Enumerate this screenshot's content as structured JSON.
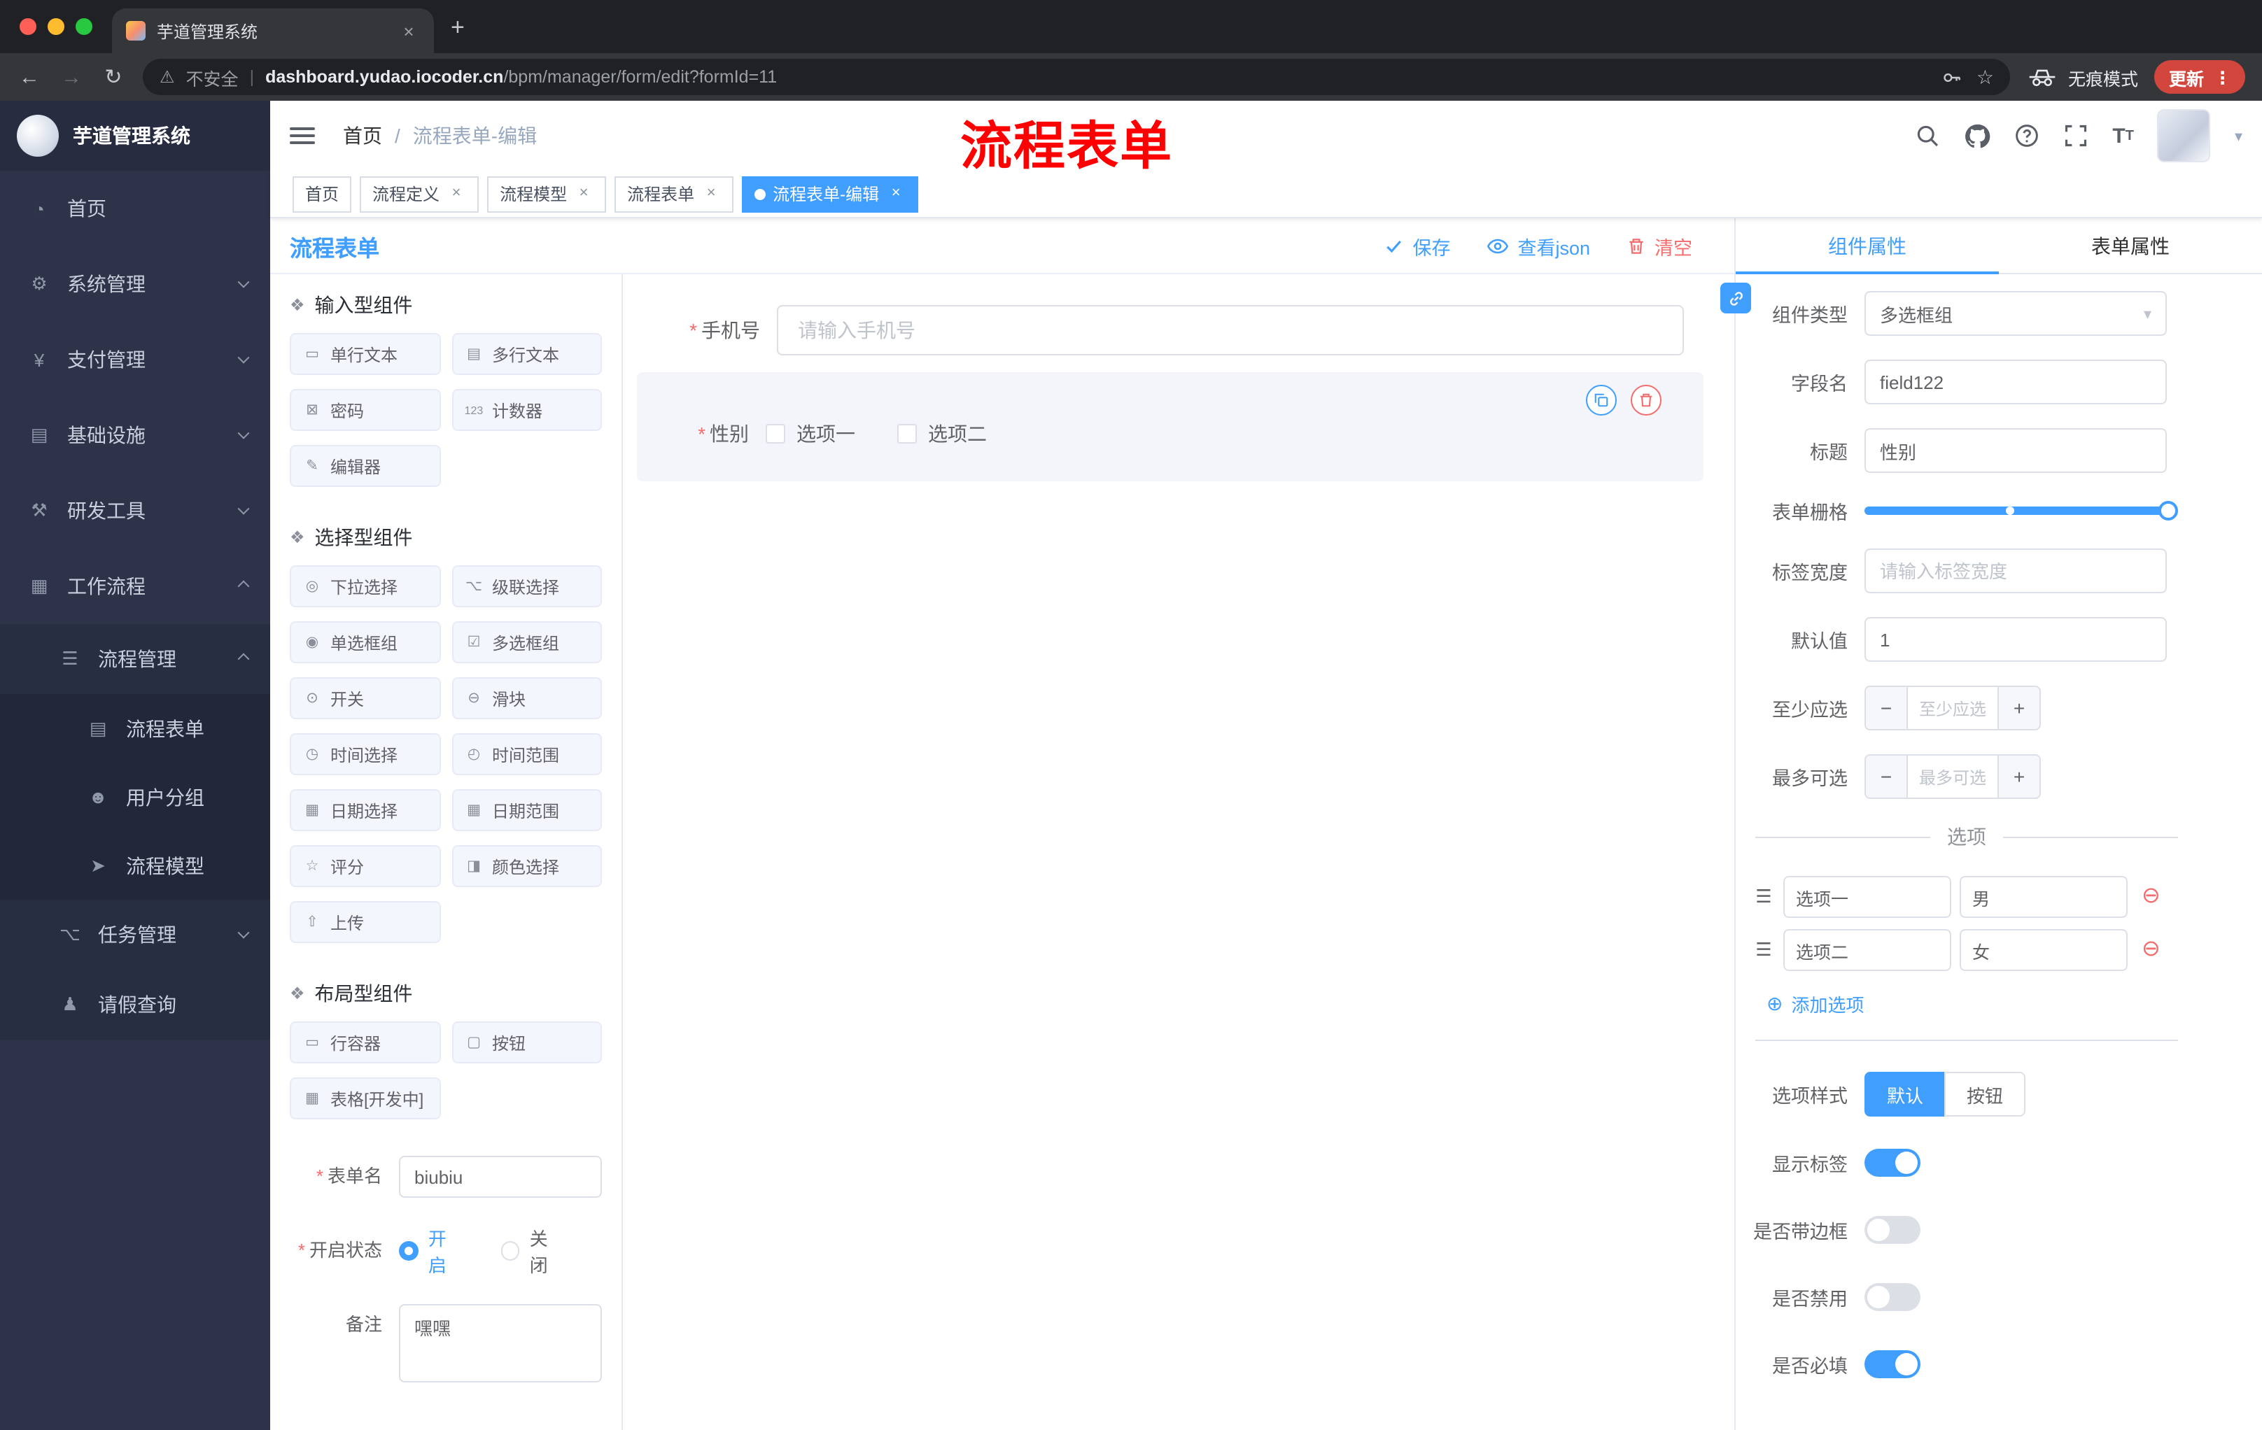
{
  "browser": {
    "tab_title": "芋道管理系统",
    "security_warning": "不安全",
    "url_domain": "dashboard.yudao.iocoder.cn",
    "url_path": "/bpm/manager/form/edit?formId=11",
    "incognito_label": "无痕模式",
    "update_button": "更新",
    "icons": [
      "back-icon",
      "forward-icon",
      "reload-icon",
      "warning-icon",
      "key-icon",
      "star-icon",
      "incognito-icon",
      "menu-dots-icon"
    ]
  },
  "glyphs": {
    "close": "×",
    "plus": "+",
    "minus": "−",
    "asterisk": "*",
    "slash": "/",
    "caret_down": "▾",
    "dots": "⋮",
    "back": "←",
    "forward": "→",
    "reload": "↻",
    "warning": "⚠",
    "star": "☆",
    "bar": "|",
    "drag": "☰",
    "remove": "⊖",
    "add": "⊕",
    "t_big": "T",
    "t_small": "T"
  },
  "sidebar": {
    "logo_title": "芋道管理系统",
    "menu": [
      {
        "label": "首页",
        "icon": "dashboard-icon",
        "glyph": "◔"
      },
      {
        "label": "系统管理",
        "icon": "gear-icon",
        "glyph": "⚙"
      },
      {
        "label": "支付管理",
        "icon": "payment-icon",
        "glyph": "¥"
      },
      {
        "label": "基础设施",
        "icon": "infrastructure-icon",
        "glyph": "▤"
      },
      {
        "label": "研发工具",
        "icon": "devtools-icon",
        "glyph": "⚒"
      },
      {
        "label": "工作流程",
        "icon": "workflow-icon",
        "glyph": "▦"
      },
      {
        "label": "流程管理",
        "icon": "process-management-icon",
        "glyph": "☰"
      },
      {
        "label": "流程表单",
        "icon": "process-form-icon",
        "glyph": "▤"
      },
      {
        "label": "用户分组",
        "icon": "user-group-icon",
        "glyph": "☻"
      },
      {
        "label": "流程模型",
        "icon": "process-model-icon",
        "glyph": "➤"
      },
      {
        "label": "任务管理",
        "icon": "task-management-icon",
        "glyph": "⌥"
      },
      {
        "label": "请假查询",
        "icon": "leave-query-icon",
        "glyph": "♟"
      }
    ]
  },
  "header": {
    "breadcrumb": [
      "首页",
      "流程表单-编辑"
    ],
    "annotation": "流程表单",
    "action_icons": [
      "search-icon",
      "github-icon",
      "help-icon",
      "fullscreen-icon",
      "font-size-icon",
      "avatar",
      "caret-down-icon"
    ]
  },
  "tags": [
    {
      "label": "首页",
      "closable": false,
      "active": false
    },
    {
      "label": "流程定义",
      "closable": true,
      "active": false
    },
    {
      "label": "流程模型",
      "closable": true,
      "active": false
    },
    {
      "label": "流程表单",
      "closable": true,
      "active": false
    },
    {
      "label": "流程表单-编辑",
      "closable": true,
      "active": true
    }
  ],
  "designer": {
    "panel_title": "流程表单",
    "toolbar": {
      "save": {
        "label": "保存",
        "icon": "check-icon"
      },
      "view_json": {
        "label": "查看json",
        "icon": "eye-icon"
      },
      "clear": {
        "label": "清空",
        "icon": "trash-icon"
      }
    }
  },
  "palette": {
    "sections": [
      {
        "title": "输入型组件",
        "icon": "component-icon",
        "glyph": "❖",
        "items": [
          {
            "label": "单行文本",
            "icon": "single-line-text-icon",
            "glyph": "▭"
          },
          {
            "label": "多行文本",
            "icon": "multiline-text-icon",
            "glyph": "▤"
          },
          {
            "label": "密码",
            "icon": "password-icon",
            "glyph": "⊠"
          },
          {
            "label": "计数器",
            "icon": "counter-icon",
            "glyph": "123"
          },
          {
            "label": "编辑器",
            "icon": "editor-icon",
            "glyph": "✎"
          }
        ]
      },
      {
        "title": "选择型组件",
        "icon": "component-icon",
        "glyph": "❖",
        "items": [
          {
            "label": "下拉选择",
            "icon": "select-icon",
            "glyph": "◎"
          },
          {
            "label": "级联选择",
            "icon": "cascader-icon",
            "glyph": "⌥"
          },
          {
            "label": "单选框组",
            "icon": "radio-group-icon",
            "glyph": "◉"
          },
          {
            "label": "多选框组",
            "icon": "checkbox-group-icon",
            "glyph": "☑"
          },
          {
            "label": "开关",
            "icon": "switch-icon",
            "glyph": "⊙"
          },
          {
            "label": "滑块",
            "icon": "slider-icon",
            "glyph": "⊖"
          },
          {
            "label": "时间选择",
            "icon": "time-picker-icon",
            "glyph": "◷"
          },
          {
            "label": "时间范围",
            "icon": "time-range-icon",
            "glyph": "◴"
          },
          {
            "label": "日期选择",
            "icon": "date-picker-icon",
            "glyph": "▦"
          },
          {
            "label": "日期范围",
            "icon": "date-range-icon",
            "glyph": "▦"
          },
          {
            "label": "评分",
            "icon": "rate-icon",
            "glyph": "☆"
          },
          {
            "label": "颜色选择",
            "icon": "color-picker-icon",
            "glyph": "◨"
          },
          {
            "label": "上传",
            "icon": "upload-icon",
            "glyph": "⇧"
          }
        ]
      },
      {
        "title": "布局型组件",
        "icon": "component-icon",
        "glyph": "❖",
        "items": [
          {
            "label": "行容器",
            "icon": "row-container-icon",
            "glyph": "▭"
          },
          {
            "label": "按钮",
            "icon": "button-icon",
            "glyph": "▢"
          },
          {
            "label": "表格[开发中]",
            "icon": "table-icon",
            "glyph": "▦"
          }
        ]
      }
    ],
    "form": {
      "name_label": "表单名",
      "name_value": "biubiu",
      "status_label": "开启状态",
      "status_on": "开启",
      "status_off": "关闭",
      "remark_label": "备注",
      "remark_value": "嘿嘿"
    }
  },
  "canvas": {
    "fields": [
      {
        "label": "手机号",
        "required": true,
        "placeholder": "请输入手机号"
      },
      {
        "label": "性别",
        "required": true,
        "options": [
          "选项一",
          "选项二"
        ],
        "selected": true,
        "actions": [
          "copy-icon",
          "trash-icon"
        ]
      }
    ]
  },
  "props": {
    "tabs": {
      "component": "组件属性",
      "form": "表单属性"
    },
    "component_type_label": "组件类型",
    "component_type_value": "多选框组",
    "field_name_label": "字段名",
    "field_name_value": "field122",
    "title_label": "标题",
    "title_value": "性别",
    "grid_label": "表单栅格",
    "label_width_label": "标签宽度",
    "label_width_placeholder": "请输入标签宽度",
    "default_label": "默认值",
    "default_value": "1",
    "min_label": "至少应选",
    "min_placeholder": "至少应选",
    "max_label": "最多可选",
    "max_placeholder": "最多可选",
    "options_divider": "选项",
    "options": [
      {
        "name": "选项一",
        "value": "男"
      },
      {
        "name": "选项二",
        "value": "女"
      }
    ],
    "add_option": "添加选项",
    "option_style_label": "选项样式",
    "option_style_default": "默认",
    "option_style_button": "按钮",
    "switches": [
      {
        "label": "显示标签",
        "on": true
      },
      {
        "label": "是否带边框",
        "on": false
      },
      {
        "label": "是否禁用",
        "on": false
      },
      {
        "label": "是否必填",
        "on": true
      }
    ]
  },
  "colors": {
    "accent": "#409eff",
    "danger": "#f56c6c",
    "annotation_red": "#ff0000",
    "sidebar_bg": "#2e3349"
  }
}
